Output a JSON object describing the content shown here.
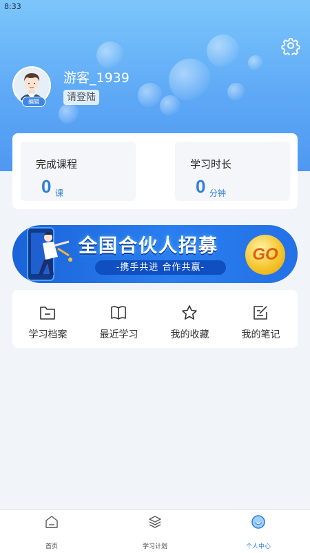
{
  "status_bar": {
    "time": "8:33"
  },
  "profile": {
    "username": "游客_1939",
    "login_label": "请登陆",
    "avatar_badge": "编辑"
  },
  "stats": [
    {
      "label": "完成课程",
      "value": "0",
      "unit": "课"
    },
    {
      "label": "学习时长",
      "value": "0",
      "unit": "分钟"
    }
  ],
  "banner": {
    "title": "全国合伙人招募",
    "subtitle": "-携手共进 合作共赢-",
    "go_label": "GO"
  },
  "menu": [
    {
      "label": "学习档案",
      "icon": "folder-icon"
    },
    {
      "label": "最近学习",
      "icon": "book-icon"
    },
    {
      "label": "我的收藏",
      "icon": "star-icon"
    },
    {
      "label": "我的笔记",
      "icon": "note-icon"
    }
  ],
  "tabs": [
    {
      "label": "首页",
      "icon": "home-icon",
      "active": false
    },
    {
      "label": "学习计划",
      "icon": "layers-icon",
      "active": false
    },
    {
      "label": "个人中心",
      "icon": "profile-icon",
      "active": true
    }
  ],
  "colors": {
    "accent": "#2f7fe0",
    "header_top": "#7cc6fb",
    "header_bottom": "#4f98f2",
    "page_bg": "#f1f4f8"
  }
}
